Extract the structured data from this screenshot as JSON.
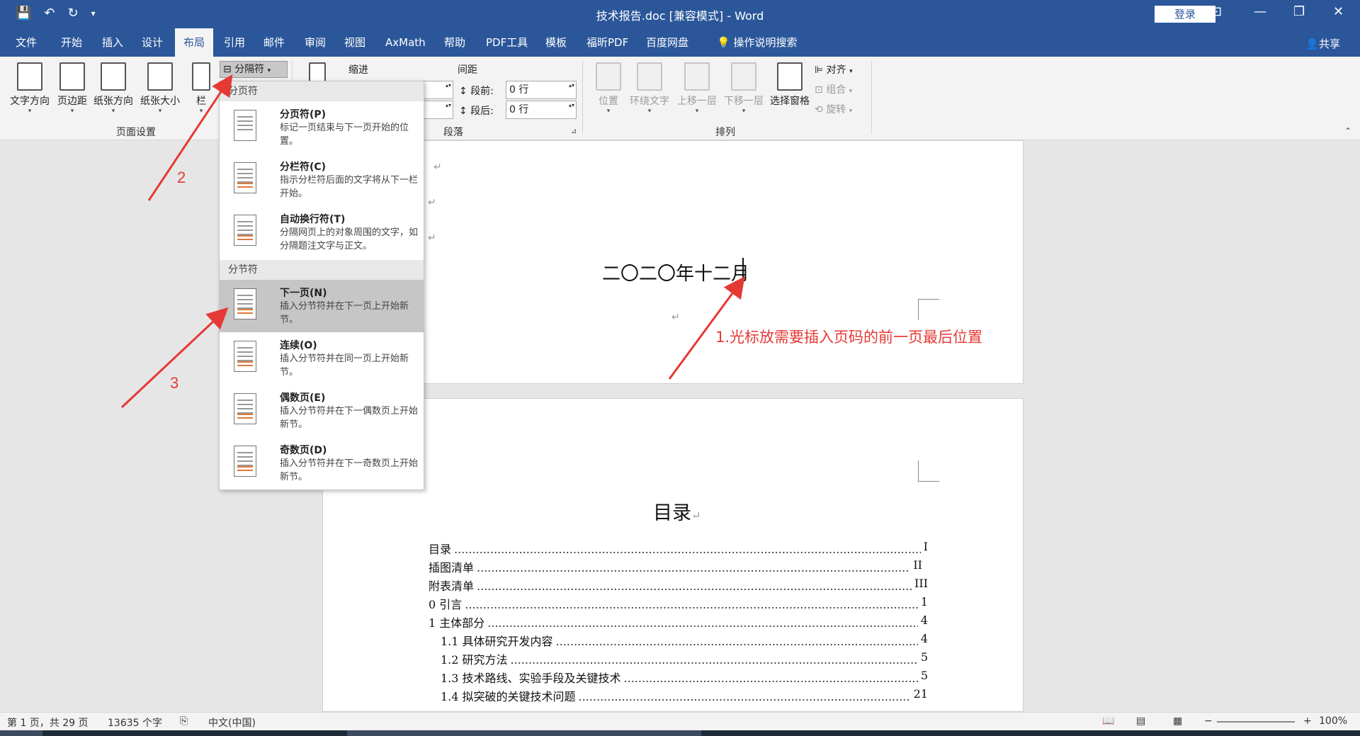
{
  "window": {
    "title": "技术报告.doc [兼容模式] - Word",
    "login": "登录"
  },
  "tabs": [
    "文件",
    "开始",
    "插入",
    "设计",
    "布局",
    "引用",
    "邮件",
    "审阅",
    "视图",
    "AxMath",
    "帮助",
    "PDF工具",
    "模板",
    "福昕PDF",
    "百度网盘"
  ],
  "tell_me": "操作说明搜索",
  "share": "共享",
  "ribbon": {
    "page_setup": {
      "text_direction": "文字方向",
      "margins": "页边距",
      "orientation": "纸张方向",
      "size": "纸张大小",
      "columns": "栏",
      "label": "页面设置"
    },
    "breaks_button": "分隔符",
    "indent_label": "缩进",
    "spacing_label": "间距",
    "before_label": "段前:",
    "before_value": "0 行",
    "after_label": "段后:",
    "after_value": "0 行",
    "paragraph_label": "段落",
    "arrange": {
      "position": "位置",
      "wrap": "环绕文字",
      "forward": "上移一层",
      "backward": "下移一层",
      "selection_pane": "选择窗格",
      "align": "对齐",
      "group": "组合",
      "rotate": "旋转",
      "label": "排列"
    }
  },
  "dropdown": {
    "page_breaks_header": "分页符",
    "section_breaks_header": "分节符",
    "items": [
      {
        "name": "分页符(P)",
        "desc": "标记一页结束与下一页开始的位置。"
      },
      {
        "name": "分栏符(C)",
        "desc": "指示分栏符后面的文字将从下一栏开始。"
      },
      {
        "name": "自动换行符(T)",
        "desc": "分隔网页上的对象周围的文字，如分隔题注文字与正文。"
      },
      {
        "name": "下一页(N)",
        "desc": "插入分节符并在下一页上开始新节。"
      },
      {
        "name": "连续(O)",
        "desc": "插入分节符并在同一页上开始新节。"
      },
      {
        "name": "偶数页(E)",
        "desc": "插入分节符并在下一偶数页上开始新节。"
      },
      {
        "name": "奇数页(D)",
        "desc": "插入分节符并在下一奇数页上开始新节。"
      }
    ]
  },
  "document": {
    "date_line": "二〇二〇年十二月",
    "toc_title": "目录",
    "toc": [
      {
        "text": "目录",
        "page": "I"
      },
      {
        "text": "插图清单",
        "page": "II"
      },
      {
        "text": "附表清单",
        "page": "III"
      },
      {
        "text": "0  引言",
        "page": "1"
      },
      {
        "text": "1  主体部分",
        "page": "4"
      },
      {
        "text": "1.1 具体研究开发内容",
        "page": "4"
      },
      {
        "text": "1.2 研究方法",
        "page": "5"
      },
      {
        "text": "1.3 技术路线、实验手段及关键技术",
        "page": "5"
      },
      {
        "text": "1.4 拟突破的关键技术问题",
        "page": "21"
      }
    ]
  },
  "annotations": {
    "step1": "1.光标放需要插入页码的前一页最后位置",
    "step2": "2",
    "step3": "3"
  },
  "status": {
    "page": "第 1 页，共 29 页",
    "words": "13635 个字",
    "language": "中文(中国)",
    "zoom": "100%"
  },
  "colors": {
    "word_blue": "#2b579a",
    "annotation_red": "#e53935"
  }
}
